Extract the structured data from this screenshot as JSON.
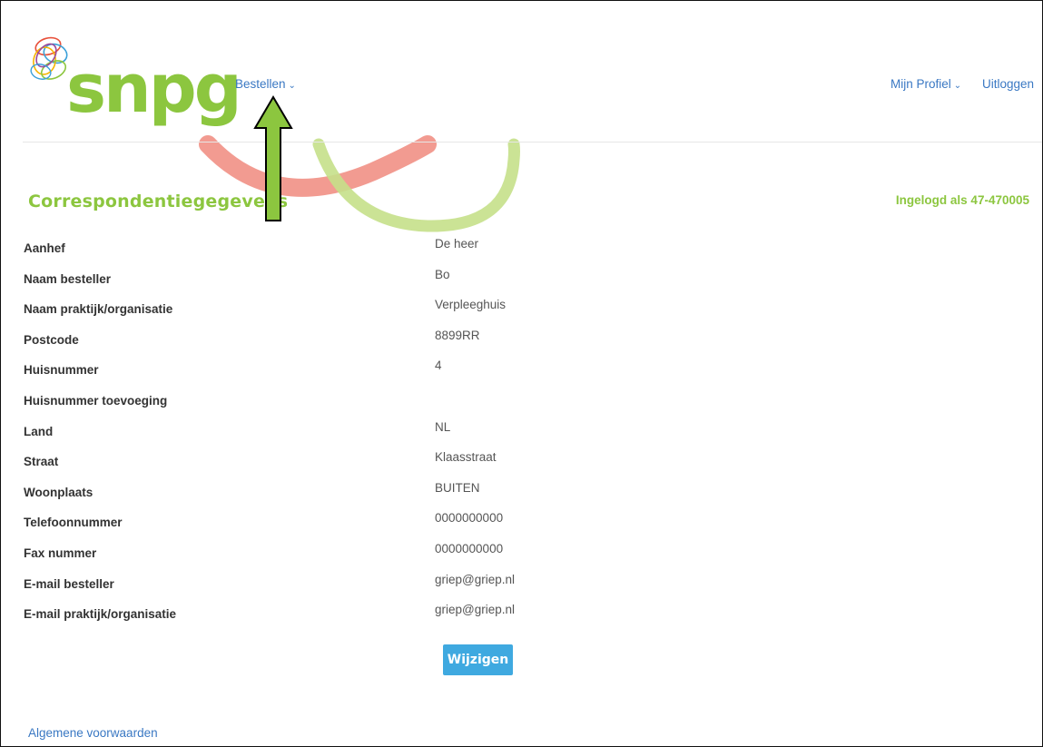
{
  "brand": {
    "logo_text": "snpg",
    "logo_color": "#8cc63f"
  },
  "nav": {
    "bestellen": "Bestellen",
    "mijn_profiel": "Mijn Profiel",
    "uitloggen": "Uitloggen",
    "chevron": "⌄"
  },
  "page": {
    "title": "Correspondentiegegevens",
    "logged_in": "Ingelogd als 47-470005"
  },
  "fields": [
    {
      "label": "Aanhef",
      "value": " De heer"
    },
    {
      "label": "Naam besteller",
      "value": "Bo"
    },
    {
      "label": "Naam praktijk/organisatie",
      "value": "Verpleeghuis"
    },
    {
      "label": "Postcode",
      "value": "8899RR"
    },
    {
      "label": "Huisnummer",
      "value": "4"
    },
    {
      "label": "Huisnummer toevoeging",
      "value": ""
    },
    {
      "label": "Land",
      "value": "NL"
    },
    {
      "label": "Straat",
      "value": "Klaasstraat"
    },
    {
      "label": "Woonplaats",
      "value": "BUITEN"
    },
    {
      "label": "Telefoonnummer",
      "value": "0000000000"
    },
    {
      "label": "Fax nummer",
      "value": "0000000000"
    },
    {
      "label": "E-mail besteller",
      "value": "griep@griep.nl"
    },
    {
      "label": "E-mail praktijk/organisatie",
      "value": "griep@griep.nl"
    }
  ],
  "actions": {
    "edit_label": "Wijzigen"
  },
  "footer": {
    "terms_link": "Algemene voorwaarden"
  },
  "colors": {
    "accent_green": "#8cc63f",
    "link_blue": "#3a78c3",
    "button_blue": "#3fa9e0",
    "ring_red": "#f08a7e",
    "arrow_green": "#8cc63f"
  }
}
